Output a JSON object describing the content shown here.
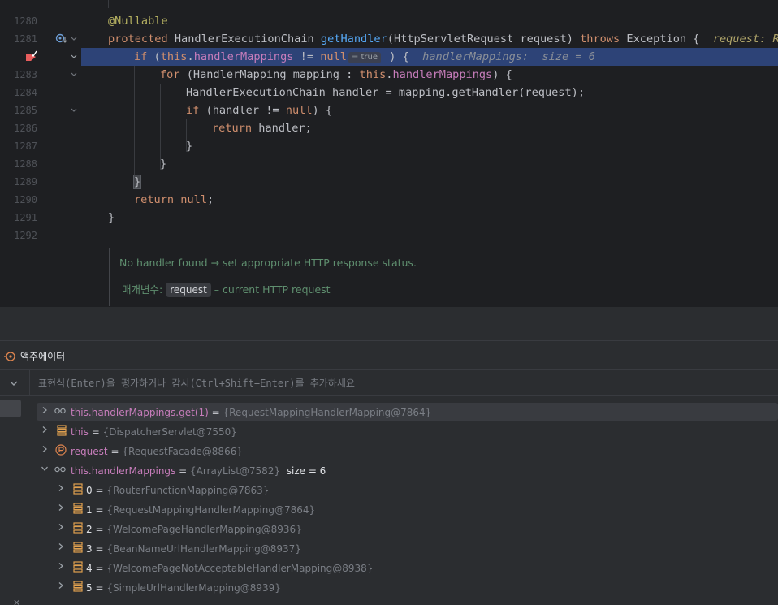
{
  "editor": {
    "line_numbers": [
      "1280",
      "1281",
      "",
      "1283",
      "1284",
      "1285",
      "1286",
      "1287",
      "1288",
      "1289",
      "1290",
      "1291",
      "1292"
    ],
    "annotation": "@Nullable",
    "method_signature": {
      "modifier": "protected",
      "return_type": "HandlerExecutionChain",
      "name": "getHandler",
      "params": "(HttpServletRequest request)",
      "throws_kw": "throws",
      "exception": "Exception {",
      "hint": "request: Re"
    },
    "current_line": {
      "kw_if": "if",
      "open": " (",
      "this_kw": "this",
      "dot": ".",
      "field": "handlerMappings",
      "op": " != ",
      "null_kw": "null",
      "inlay": "= true",
      "close": " ) {",
      "hint": "handlerMappings:  size = 6"
    },
    "for_line": {
      "kw_for": "for",
      "decl": " (HandlerMapping mapping : ",
      "this_kw": "this",
      "dot": ".",
      "field": "handlerMappings",
      "close": ") {"
    },
    "handler_line": "HandlerExecutionChain handler = mapping.getHandler(request);",
    "if2_line": {
      "kw_if": "if",
      "cond": " (handler != ",
      "null_kw": "null",
      "close": ") {"
    },
    "return_handler": {
      "kw": "return",
      "rest": " handler;"
    },
    "close_brace": "}",
    "return_null": {
      "kw": "return",
      "space": " ",
      "null_kw": "null",
      "semi": ";"
    },
    "doc": {
      "summary": "No handler found → set appropriate HTTP response status.",
      "param_label": "매개변수:",
      "param_name": "request",
      "param_desc": " – current HTTP request"
    }
  },
  "watches": {
    "title": "액추에이터",
    "eval_placeholder": "표현식(Enter)을 평가하거나 감시(Ctrl+Shift+Enter)를 추가하세요",
    "equals": " = ",
    "rows": [
      {
        "name": "this.handlerMappings.get(1)",
        "value": "{RequestMappingHandlerMapping@7864}",
        "icon": "watch-glasses-icon"
      },
      {
        "name": "this",
        "value": "{DispatcherServlet@7550}",
        "icon": "field-icon"
      },
      {
        "name": "request",
        "value": "{RequestFacade@8866}",
        "icon": "parameter-icon"
      },
      {
        "name": "this.handlerMappings",
        "value": "{ArrayList@7582}",
        "size": "size = 6",
        "icon": "watch-glasses-icon"
      }
    ],
    "children": [
      {
        "index": "0",
        "value": "{RouterFunctionMapping@7863}"
      },
      {
        "index": "1",
        "value": "{RequestMappingHandlerMapping@7864}"
      },
      {
        "index": "2",
        "value": "{WelcomePageHandlerMapping@8936}"
      },
      {
        "index": "3",
        "value": "{BeanNameUrlHandlerMapping@8937}"
      },
      {
        "index": "4",
        "value": "{WelcomePageNotAcceptableHandlerMapping@8938}"
      },
      {
        "index": "5",
        "value": "{SimpleUrlHandlerMapping@8939}"
      }
    ]
  },
  "colors": {
    "editor_bg": "#1e1f22",
    "panel_bg": "#2b2d30",
    "current_line": "#2d4377",
    "keyword": "#cf8e6d",
    "field": "#c77dbb",
    "method": "#56a8f5",
    "annotation": "#b3ae60"
  }
}
